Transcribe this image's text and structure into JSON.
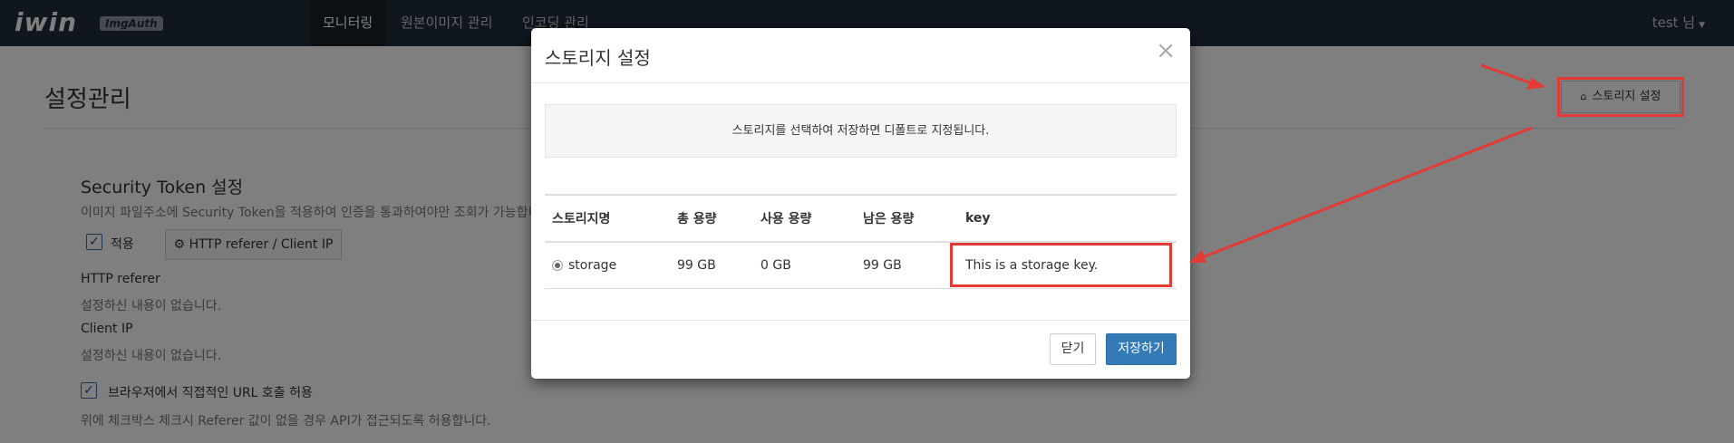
{
  "navbar": {
    "logo_text": "iwin",
    "brand_badge": "ImgAuth",
    "items": [
      {
        "label": "모니터링",
        "active": true
      },
      {
        "label": "원본이미지 관리",
        "active": false
      },
      {
        "label": "인코딩 관리",
        "active": false
      }
    ],
    "user_label": "test 님",
    "bg_color": "#1f2d3d"
  },
  "page": {
    "title": "설정관리",
    "storage_button_label": "스토리지 설정",
    "security_section": {
      "title": "Security Token 설정",
      "description": "이미지 파일주소에 Security Token을 적용하여 인증을 통과하여야만 조회가 가능합니",
      "apply_label": "적용",
      "apply_checked": true,
      "referer_button_label": "HTTP referer / Client IP",
      "http_referer_label": "HTTP referer",
      "http_referer_value": "설정하신 내용이 없습니다.",
      "client_ip_label": "Client IP",
      "client_ip_value": "설정하신 내용이 없습니다.",
      "direct_url_label": "브라우저에서 직접적인 URL 호출 허용",
      "direct_url_checked": true,
      "direct_url_desc": "위에 체크박스 체크시 Referer 값이 없을 경우 API가 접근되도록 허용합니다."
    }
  },
  "modal": {
    "title": "스토리지 설정",
    "close_glyph": "×",
    "info_text": "스토리지를 선택하여 저장하면 디폴트로 지정됩니다.",
    "table": {
      "headers": [
        "스토리지명",
        "총 용량",
        "사용 용량",
        "남은 용량",
        "key"
      ],
      "rows": [
        {
          "name": "storage",
          "total": "99 GB",
          "used": "0 GB",
          "remaining": "99 GB",
          "key": "This is a storage key.",
          "selected": true
        }
      ]
    },
    "close_button_label": "닫기",
    "save_button_label": "저장하기",
    "primary_color": "#337ab7"
  },
  "annotation_color": "#e53935"
}
